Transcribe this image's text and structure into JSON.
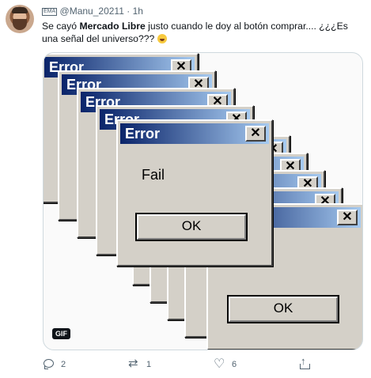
{
  "tweet": {
    "display_name_badge": "EMA",
    "handle": "@Manu_20211",
    "separator": "·",
    "time": "1h",
    "text_part1": "Se cayó ",
    "text_bold": "Mercado Libre",
    "text_part2": " justo cuando le doy al botón comprar.... ¿¿¿Es una señal del universo??? ",
    "emoji": "rolling-on-the-floor-laughing-emoji"
  },
  "media": {
    "type": "gif",
    "gif_label": "GIF",
    "windows_back": [
      {
        "title": "Error"
      },
      {
        "title": "Error"
      },
      {
        "title": "Error"
      },
      {
        "title": "Error"
      }
    ],
    "windows_right": [
      {
        "title": ""
      },
      {
        "title": ""
      },
      {
        "title": ""
      },
      {
        "title": ""
      }
    ],
    "front_window": {
      "title": "Error",
      "close": "✕",
      "message": "Fail",
      "ok_label": "OK"
    },
    "right_window": {
      "close": "✕",
      "ok_label": "OK"
    }
  },
  "actions": {
    "reply_count": "2",
    "retweet_count": "1",
    "like_count": "6"
  }
}
